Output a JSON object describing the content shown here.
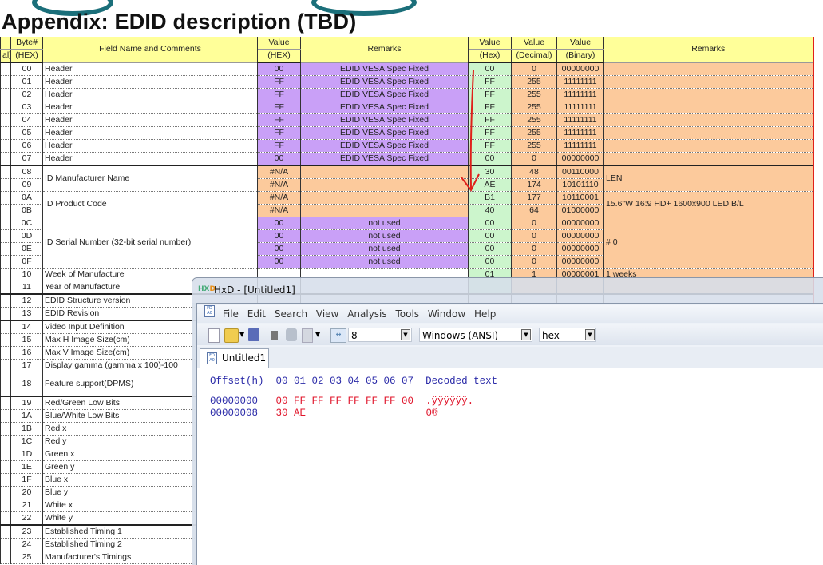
{
  "slide_title": "Appendix: EDID description (TBD)",
  "sheet": {
    "headers_row1": [
      "",
      "Byte#",
      "Field Name and Comments",
      "Value",
      "Remarks",
      "Value",
      "Value",
      "Value",
      "Remarks"
    ],
    "headers_row2": [
      "al)",
      "(HEX)",
      "",
      "(HEX)",
      "",
      "(Hex)",
      "(Decimal)",
      "(Binary)",
      ""
    ],
    "rows": [
      {
        "byte": "00",
        "field": "Header",
        "vhex": "00",
        "remark": "EDID VESA Spec Fixed",
        "kind": "purple",
        "hex": "00",
        "dec": "0",
        "bin": "00000000"
      },
      {
        "byte": "01",
        "field": "Header",
        "vhex": "FF",
        "remark": "EDID VESA Spec Fixed",
        "kind": "purple",
        "hex": "FF",
        "dec": "255",
        "bin": "11111111"
      },
      {
        "byte": "02",
        "field": "Header",
        "vhex": "FF",
        "remark": "EDID VESA Spec Fixed",
        "kind": "purple",
        "hex": "FF",
        "dec": "255",
        "bin": "11111111"
      },
      {
        "byte": "03",
        "field": "Header",
        "vhex": "FF",
        "remark": "EDID VESA Spec Fixed",
        "kind": "purple",
        "hex": "FF",
        "dec": "255",
        "bin": "11111111"
      },
      {
        "byte": "04",
        "field": "Header",
        "vhex": "FF",
        "remark": "EDID VESA Spec Fixed",
        "kind": "purple",
        "hex": "FF",
        "dec": "255",
        "bin": "11111111"
      },
      {
        "byte": "05",
        "field": "Header",
        "vhex": "FF",
        "remark": "EDID VESA Spec Fixed",
        "kind": "purple",
        "hex": "FF",
        "dec": "255",
        "bin": "11111111"
      },
      {
        "byte": "06",
        "field": "Header",
        "vhex": "FF",
        "remark": "EDID VESA Spec Fixed",
        "kind": "purple",
        "hex": "FF",
        "dec": "255",
        "bin": "11111111"
      },
      {
        "byte": "07",
        "field": "Header",
        "vhex": "00",
        "remark": "EDID VESA Spec Fixed",
        "kind": "purple",
        "hex": "00",
        "dec": "0",
        "bin": "00000000"
      },
      {
        "byte": "08",
        "field": "ID Manufacturer Name",
        "field_rows": 2,
        "vhex": "#N/A",
        "remark": "",
        "kind": "orange",
        "hex": "30",
        "dec": "48",
        "bin": "00110000",
        "remark2": "LEN",
        "remark2_rows": 2,
        "thick": true
      },
      {
        "byte": "09",
        "vhex": "#N/A",
        "remark": "",
        "kind": "orange",
        "hex": "AE",
        "dec": "174",
        "bin": "10101110"
      },
      {
        "byte": "0A",
        "field": "ID Product Code",
        "field_rows": 2,
        "vhex": "#N/A",
        "remark": "",
        "kind": "orange",
        "hex": "B1",
        "dec": "177",
        "bin": "10110001",
        "remark2": "15.6\"W 16:9 HD+ 1600x900 LED B/L",
        "remark2_rows": 2
      },
      {
        "byte": "0B",
        "vhex": "#N/A",
        "remark": "",
        "kind": "orange",
        "hex": "40",
        "dec": "64",
        "bin": "01000000"
      },
      {
        "byte": "0C",
        "field": "ID Serial Number (32-bit serial number)",
        "field_rows": 4,
        "vhex": "00",
        "remark": "not used",
        "kind": "purple",
        "hex": "00",
        "dec": "0",
        "bin": "00000000",
        "remark2": "# 0",
        "remark2_rows": 4
      },
      {
        "byte": "0D",
        "vhex": "00",
        "remark": "not used",
        "kind": "purple",
        "hex": "00",
        "dec": "0",
        "bin": "00000000"
      },
      {
        "byte": "0E",
        "vhex": "00",
        "remark": "not used",
        "kind": "purple",
        "hex": "00",
        "dec": "0",
        "bin": "00000000"
      },
      {
        "byte": "0F",
        "vhex": "00",
        "remark": "not used",
        "kind": "purple",
        "hex": "00",
        "dec": "0",
        "bin": "00000000"
      },
      {
        "byte": "10",
        "field": "Week of Manufacture",
        "vhex": "",
        "remark": "",
        "kind": "white",
        "hex": "01",
        "dec": "1",
        "bin": "00000001",
        "remark2": "1 weeks"
      },
      {
        "byte": "11",
        "field": "Year of Manufacture",
        "kind": "white",
        "hex": "",
        "dec": "",
        "bin": ""
      },
      {
        "byte": "12",
        "field": "EDID Structure version",
        "kind": "white",
        "thick": true
      },
      {
        "byte": "13",
        "field": "EDID Revision",
        "kind": "white"
      },
      {
        "byte": "14",
        "field": "Video Input Definition",
        "kind": "white",
        "thick": true
      },
      {
        "byte": "15",
        "field": "Max H Image Size(cm)",
        "kind": "white"
      },
      {
        "byte": "16",
        "field": "Max V Image Size(cm)",
        "kind": "white"
      },
      {
        "byte": "17",
        "field": "Display gamma (gamma x 100)-100",
        "kind": "white"
      },
      {
        "byte": "18",
        "field": "Feature support(DPMS)",
        "kind": "white",
        "tall": true
      },
      {
        "byte": "19",
        "field": "Red/Green Low Bits",
        "kind": "white",
        "thick": true
      },
      {
        "byte": "1A",
        "field": "Blue/White Low Bits",
        "kind": "white"
      },
      {
        "byte": "1B",
        "field": "Red x",
        "kind": "white"
      },
      {
        "byte": "1C",
        "field": "Red y",
        "kind": "white"
      },
      {
        "byte": "1D",
        "field": "Green x",
        "kind": "white"
      },
      {
        "byte": "1E",
        "field": "Green y",
        "kind": "white"
      },
      {
        "byte": "1F",
        "field": "Blue x",
        "kind": "white"
      },
      {
        "byte": "20",
        "field": "Blue y",
        "kind": "white"
      },
      {
        "byte": "21",
        "field": "White x",
        "kind": "white"
      },
      {
        "byte": "22",
        "field": "White y",
        "kind": "white"
      },
      {
        "byte": "23",
        "field": "Established Timing 1",
        "kind": "white",
        "thick": true
      },
      {
        "byte": "24",
        "field": "Established Timing 2",
        "kind": "white"
      },
      {
        "byte": "25",
        "field": "Manufacturer's Timings",
        "kind": "white"
      }
    ]
  },
  "hxd": {
    "title": "HxD - [Untitled1]",
    "menu": [
      "File",
      "Edit",
      "Search",
      "View",
      "Analysis",
      "Tools",
      "Window",
      "Help"
    ],
    "bytes_per_row": "8",
    "charset": "Windows (ANSI)",
    "offset_base": "hex",
    "tab": "Untitled1",
    "header": {
      "offset": "Offset(h)",
      "columns": "00 01 02 03 04 05 06 07",
      "decoded": "Decoded text"
    },
    "lines": [
      {
        "offset": "00000000",
        "bytes": "00 FF FF FF FF FF FF 00",
        "text": ".ÿÿÿÿÿÿ."
      },
      {
        "offset": "00000008",
        "bytes": "30 AE",
        "text": "0®"
      }
    ]
  },
  "colors": {
    "header": "#ffff99",
    "fixed": "#c9a0f7",
    "na": "#fcca9c",
    "hex": "#ccf5cc",
    "annotation": "#e0201a"
  }
}
